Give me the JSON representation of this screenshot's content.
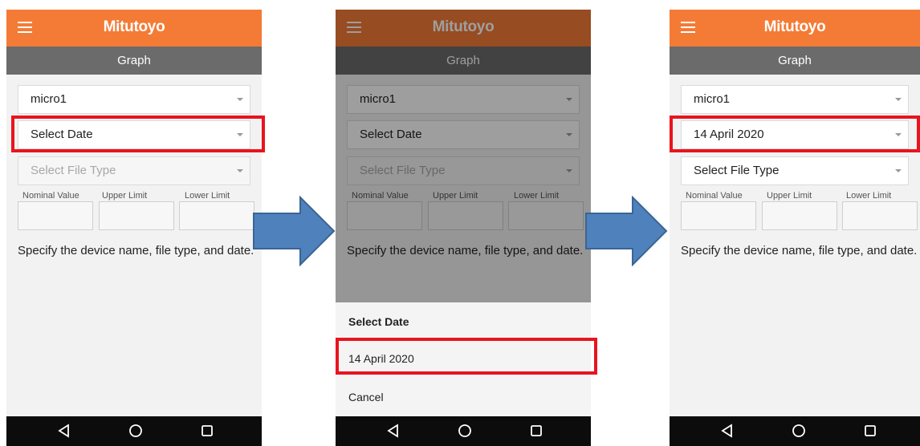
{
  "brand": "Mitutoyo",
  "screen_title": "Graph",
  "colors": {
    "header": "#f47b36",
    "subheader": "#6b6b6b",
    "highlight": "#e8141e",
    "arrow": "#4f81bd",
    "arrow_border": "#3a6592"
  },
  "icons": {
    "menu": "hamburger-icon",
    "dropdown": "chevron-down-icon",
    "back": "back-icon",
    "home": "home-icon",
    "recent": "recent-apps-icon"
  },
  "limits": {
    "nominal": "Nominal Value",
    "upper": "Upper Limit",
    "lower": "Lower Limit"
  },
  "hint": "Specify the device name, file type, and date.",
  "step1": {
    "device": "micro1",
    "date": "Select Date",
    "file_type": "Select File Type"
  },
  "step2": {
    "device": "micro1",
    "date": "Select Date",
    "file_type": "Select File Type",
    "sheet": {
      "title": "Select Date",
      "option": "14 April 2020",
      "cancel": "Cancel"
    }
  },
  "step3": {
    "device": "micro1",
    "date": "14 April 2020",
    "file_type": "Select File Type"
  }
}
